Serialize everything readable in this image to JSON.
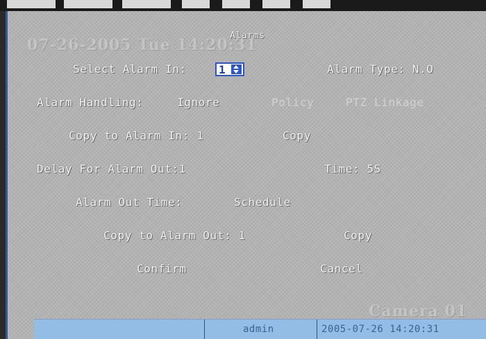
{
  "overlay": {
    "datetime": "07-26-2005 Tue 14:20:31",
    "camera": "Camera 01"
  },
  "dialog": {
    "title": "Alarms",
    "select_alarm_in_label": "Select Alarm In:",
    "select_alarm_in_value": "1",
    "alarm_type": "Alarm Type: N.O",
    "alarm_handling_label": "Alarm Handling:",
    "alarm_handling_value": "Ignore",
    "policy_label": "Policy",
    "ptz_linkage_label": "PTZ Linkage",
    "copy_to_alarm_in": "Copy to Alarm In: 1",
    "copy_label": "Copy",
    "delay_for_alarm_out": "Delay For Alarm Out:1",
    "time": "Time: 5S",
    "alarm_out_time_label": "Alarm Out Time:",
    "schedule_label": "Schedule",
    "copy_to_alarm_out": "Copy to Alarm Out: 1",
    "copy2_label": "Copy",
    "confirm_label": "Confirm",
    "cancel_label": "Cancel"
  },
  "statusbar": {
    "user": "admin",
    "datetime": "2005-07-26 14:20:31"
  },
  "colors": {
    "screen_bg": "#b3b3b3",
    "text": "#f7f7f7",
    "selector_border": "#2d56c8",
    "statusbar_bg": "#94bde6",
    "statusbar_text": "#3d5f96"
  }
}
